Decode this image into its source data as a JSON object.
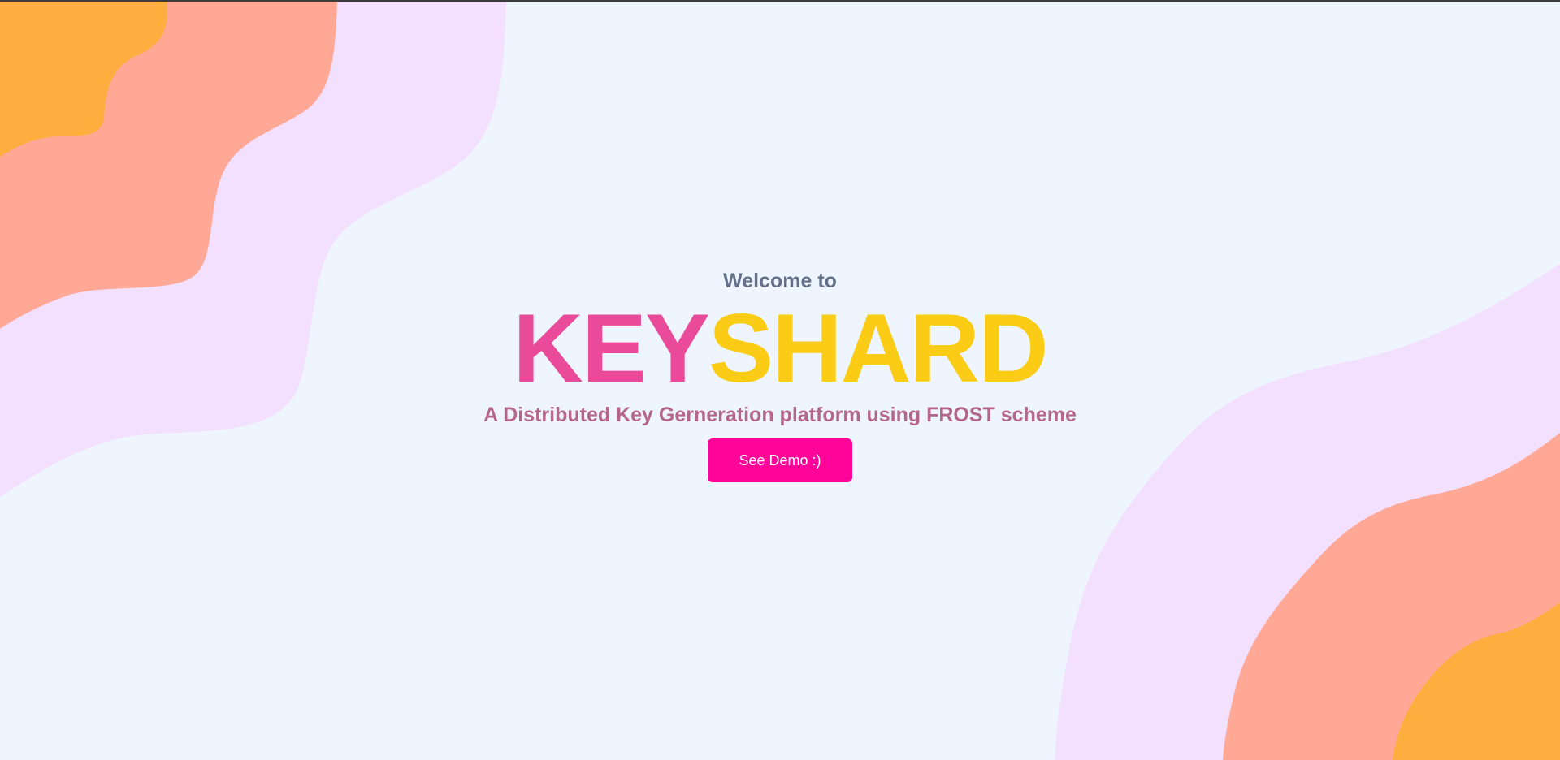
{
  "hero": {
    "welcome_text": "Welcome to",
    "title_part_a": "KEY",
    "title_part_b": "SHARD",
    "subtitle": "A Distributed Key Gerneration platform using FROST scheme",
    "cta_label": "See Demo :)"
  },
  "colors": {
    "background": "#eff5fe",
    "title_part_a": "#ea4a9a",
    "title_part_b": "#facc15",
    "cta_background": "#ff0499",
    "wave_lavender": "#f3e0fe",
    "wave_salmon": "#ffa896",
    "wave_orange": "#fdae3f"
  }
}
